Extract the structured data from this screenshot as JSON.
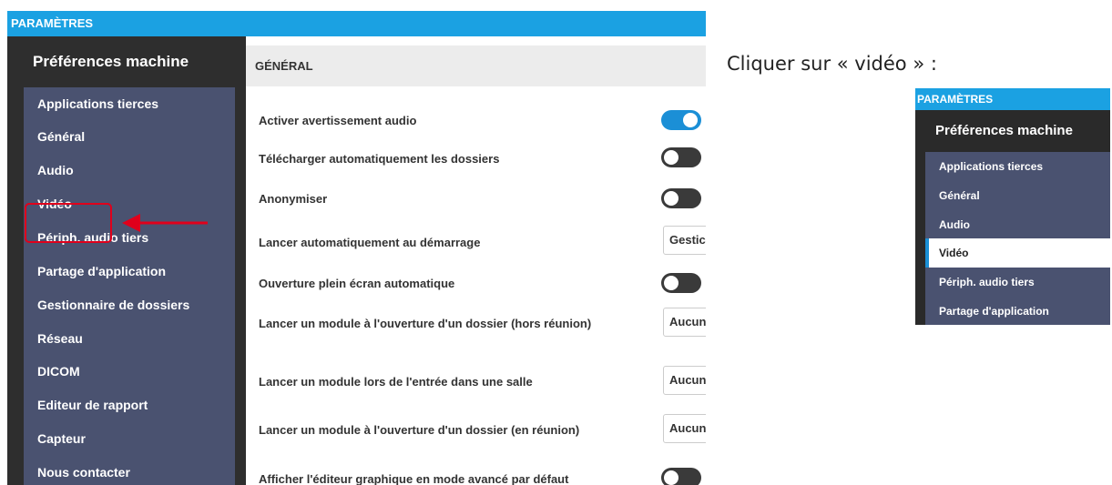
{
  "main_panel": {
    "title": "PARAMÈTRES",
    "sidebar_header": "Préférences machine",
    "menu": [
      {
        "label": "Applications tierces"
      },
      {
        "label": "Général"
      },
      {
        "label": "Audio"
      },
      {
        "label": "Vidéo"
      },
      {
        "label": "Périph. audio tiers"
      },
      {
        "label": "Partage d'application"
      },
      {
        "label": "Gestionnaire de dossiers"
      },
      {
        "label": "Réseau"
      },
      {
        "label": "DICOM"
      },
      {
        "label": "Editeur de rapport"
      },
      {
        "label": "Capteur"
      },
      {
        "label": "Nous contacter"
      }
    ],
    "content_header": "GÉNÉRAL",
    "settings": [
      {
        "label": "Activer avertissement audio",
        "control": "toggle",
        "on": true
      },
      {
        "label": "Télécharger automatiquement les dossiers",
        "control": "toggle",
        "on": false
      },
      {
        "label": "Anonymiser",
        "control": "toggle",
        "on": false
      },
      {
        "label": "Lancer automatiquement au démarrage",
        "control": "select",
        "value": "Gestic"
      },
      {
        "label": "Ouverture plein écran automatique",
        "control": "toggle",
        "on": false
      },
      {
        "label": "Lancer un module à l'ouverture d'un dossier (hors réunion)",
        "control": "select",
        "value": "Aucun"
      },
      {
        "label": "Lancer un module lors de l'entrée dans une salle",
        "control": "select",
        "value": "Aucun"
      },
      {
        "label": "Lancer un module à l'ouverture d'un dossier (en réunion)",
        "control": "select",
        "value": "Aucun"
      },
      {
        "label": "Afficher l'éditeur graphique en mode avancé par défaut",
        "control": "toggle",
        "on": false
      }
    ]
  },
  "caption": "Cliquer sur « vidéo » :",
  "small_panel": {
    "title": "PARAMÈTRES",
    "sidebar_header": "Préférences machine",
    "menu": [
      {
        "label": "Applications tierces"
      },
      {
        "label": "Général"
      },
      {
        "label": "Audio"
      },
      {
        "label": "Vidéo",
        "selected": true
      },
      {
        "label": "Périph. audio tiers"
      },
      {
        "label": "Partage d'application"
      }
    ]
  },
  "colors": {
    "accent": "#1ba1e2",
    "menu_bg": "#4a5270",
    "toggle_on": "#1b8fd6",
    "toggle_off": "#3a3a3a",
    "highlight": "#e0001b"
  }
}
